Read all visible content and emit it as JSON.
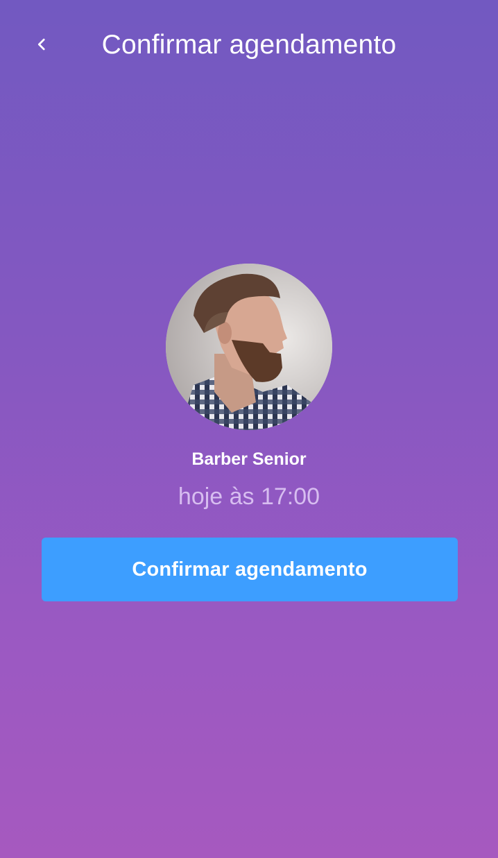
{
  "header": {
    "back_icon": "chevron-left-icon",
    "title": "Confirmar agendamento"
  },
  "barber": {
    "avatar": "barber-avatar",
    "name": "Barber Senior"
  },
  "appointment": {
    "time": "hoje às 17:00"
  },
  "actions": {
    "confirm_label": "Confirmar agendamento"
  },
  "colors": {
    "gradient_top": "#7259C1",
    "gradient_bottom": "#A659BF",
    "button": "#3D9EFF",
    "time_text": "#D7BDF0"
  }
}
